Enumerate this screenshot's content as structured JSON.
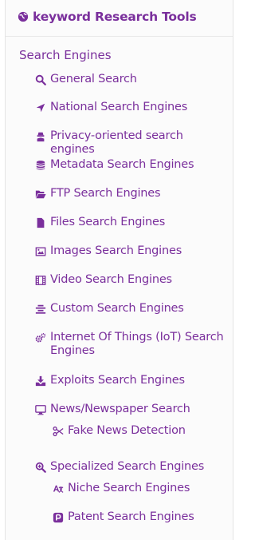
{
  "header": {
    "title": "keyword Research Tools",
    "icon": "globe-icon"
  },
  "section": {
    "title": "Search Engines"
  },
  "items": [
    {
      "label": "General Search",
      "icon": "search-icon"
    },
    {
      "label": "National Search Engines",
      "icon": "location-arrow-icon"
    },
    {
      "label": "Privacy-oriented search engines",
      "icon": "user-secret-icon"
    },
    {
      "label": "Metadata Search Engines",
      "icon": "database-icon"
    },
    {
      "label": "FTP Search Engines",
      "icon": "folder-open-icon"
    },
    {
      "label": "Files Search Engines",
      "icon": "file-icon"
    },
    {
      "label": "Images Search Engines",
      "icon": "image-icon"
    },
    {
      "label": "Video Search Engines",
      "icon": "film-icon"
    },
    {
      "label": "Custom Search Engines",
      "icon": "text-center-icon"
    },
    {
      "label": "Internet Of Things (IoT) Search Engines",
      "icon": "cogs-icon"
    },
    {
      "label": "Exploits Search Engines",
      "icon": "download-icon"
    },
    {
      "label": "News/Newspaper Search",
      "icon": "desktop-icon"
    },
    {
      "label": "Fake News Detection",
      "icon": "scissors-icon"
    },
    {
      "label": "Specialized Search Engines",
      "icon": "search-plus-icon"
    },
    {
      "label": "Niche Search Engines",
      "icon": "language-icon"
    },
    {
      "label": "Patent Search Engines",
      "icon": "patent-icon"
    }
  ],
  "colors": {
    "accent": "#7a2f9c",
    "background": "#fbfbfb",
    "border": "#e4e4e4"
  }
}
